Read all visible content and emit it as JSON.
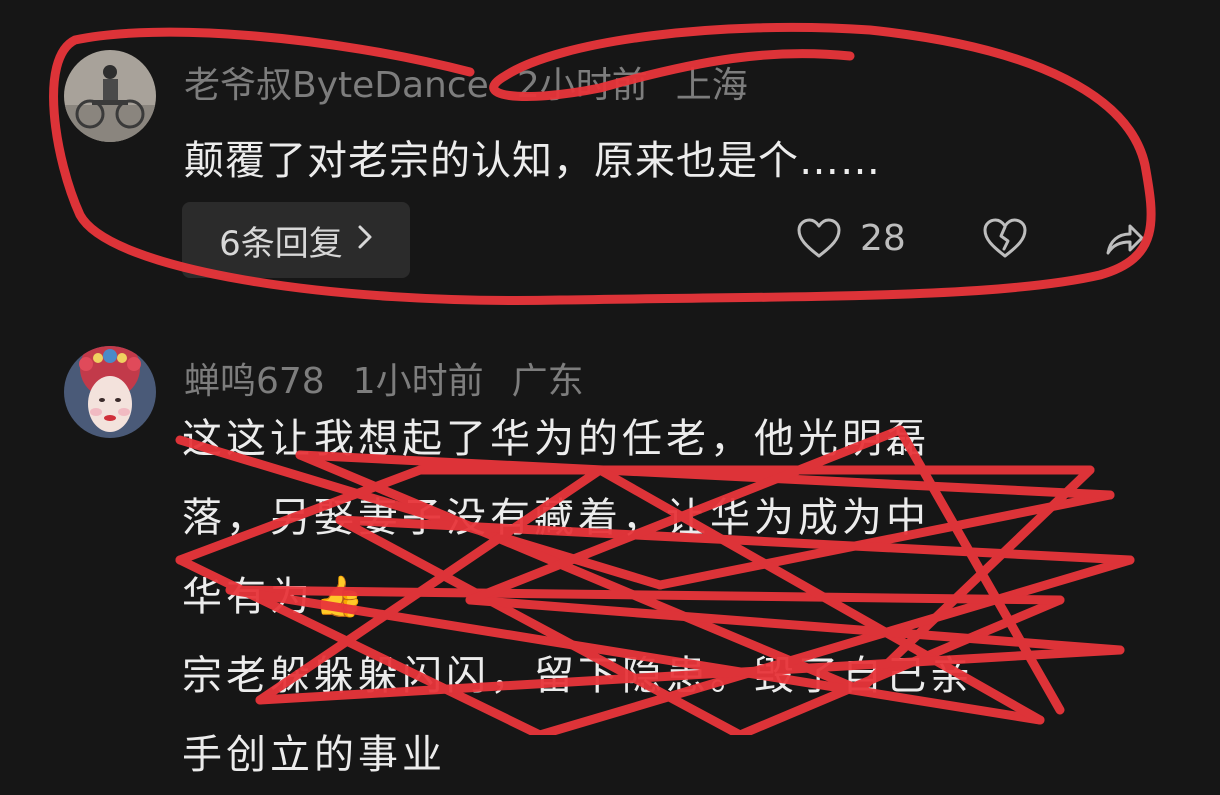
{
  "comments": [
    {
      "username": "老爷叔ByteDance",
      "time": "2小时前",
      "location": "上海",
      "text": "颠覆了对老宗的认知，原来也是个……",
      "replies_label": "6条回复",
      "likes": "28"
    },
    {
      "username": "蝉鸣678",
      "time": "1小时前",
      "location": "广东",
      "lines": [
        "这这让我想起了华为的任老，他光明磊",
        "落，另娶妻子没有藏着，让华为成为中",
        "华有为👍",
        "宗老躲躲躲闪闪，留下隐患。毁了自己亲",
        "手创立的事业"
      ]
    }
  ],
  "annotation_color": "#e8353a"
}
